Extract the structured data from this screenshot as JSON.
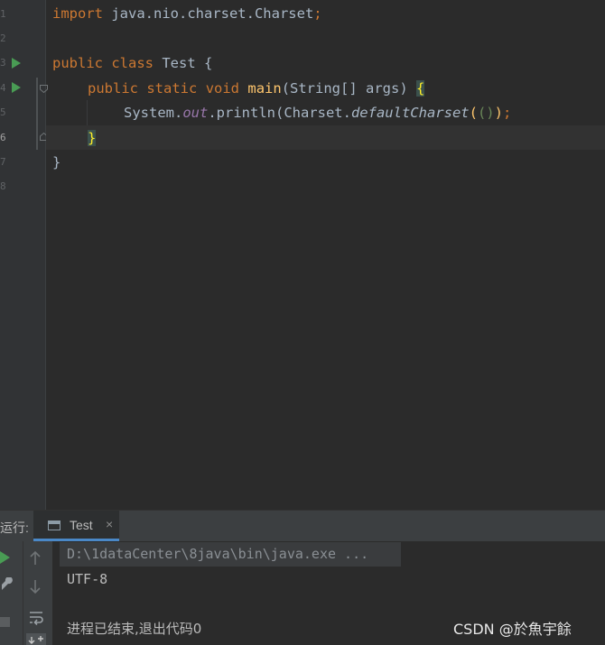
{
  "editor": {
    "line_numbers": [
      "1",
      "2",
      "3",
      "4",
      "5",
      "6",
      "7",
      "8"
    ],
    "lines": {
      "l1": {
        "kw": "import",
        "rest": " java.nio.charset.Charset",
        "semi": ";"
      },
      "l3": {
        "kw1": "public",
        "kw2": "class",
        "name": " Test ",
        "brace": "{"
      },
      "l4": {
        "kw1": "public",
        "kw2": "static",
        "kw3": "void",
        "fn": "main",
        "params": "(String[] args) ",
        "brace": "{"
      },
      "l5": {
        "a": "System.",
        "field": "out",
        "b": ".println(Charset.",
        "method": "defaultCharset",
        "p1": "(",
        "p2": "()",
        "p3": ")",
        "semi": ";"
      },
      "l6": {
        "brace": "}"
      },
      "l7": {
        "brace": "}"
      }
    }
  },
  "run_panel": {
    "label": "运行:",
    "tab_label": "Test",
    "tab_close": "×",
    "console": {
      "command": "D:\\1dataCenter\\8java\\bin\\java.exe ...",
      "output": "UTF-8",
      "exit_message": "进程已结束,退出代码0"
    }
  },
  "watermark": "CSDN @於魚宇餘",
  "icons": {
    "run": "run-icon",
    "fold": "fold-icon",
    "up": "arrow-up-icon",
    "down": "arrow-down-icon",
    "wrench": "wrench-icon",
    "wrap": "soft-wrap-icon",
    "stop": "stop-icon"
  },
  "colors": {
    "background": "#2b2b2b",
    "keyword": "#cc7832",
    "function": "#ffc66d",
    "field": "#9876aa",
    "run_green": "#499c54"
  }
}
